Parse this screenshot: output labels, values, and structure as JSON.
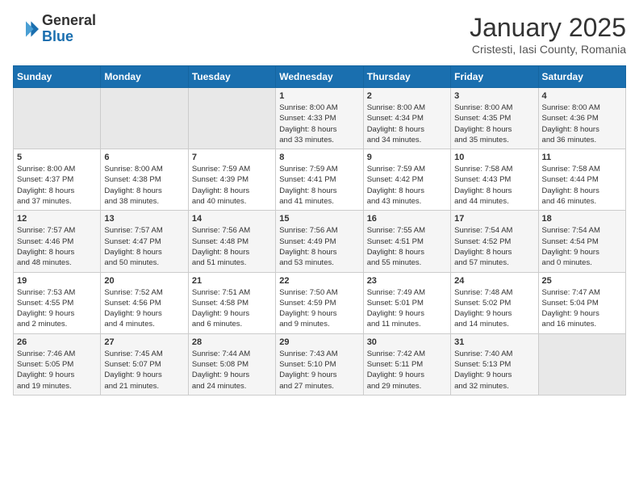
{
  "logo": {
    "general": "General",
    "blue": "Blue"
  },
  "title": "January 2025",
  "location": "Cristesti, Iasi County, Romania",
  "days_of_week": [
    "Sunday",
    "Monday",
    "Tuesday",
    "Wednesday",
    "Thursday",
    "Friday",
    "Saturday"
  ],
  "weeks": [
    [
      {
        "num": "",
        "info": ""
      },
      {
        "num": "",
        "info": ""
      },
      {
        "num": "",
        "info": ""
      },
      {
        "num": "1",
        "info": "Sunrise: 8:00 AM\nSunset: 4:33 PM\nDaylight: 8 hours\nand 33 minutes."
      },
      {
        "num": "2",
        "info": "Sunrise: 8:00 AM\nSunset: 4:34 PM\nDaylight: 8 hours\nand 34 minutes."
      },
      {
        "num": "3",
        "info": "Sunrise: 8:00 AM\nSunset: 4:35 PM\nDaylight: 8 hours\nand 35 minutes."
      },
      {
        "num": "4",
        "info": "Sunrise: 8:00 AM\nSunset: 4:36 PM\nDaylight: 8 hours\nand 36 minutes."
      }
    ],
    [
      {
        "num": "5",
        "info": "Sunrise: 8:00 AM\nSunset: 4:37 PM\nDaylight: 8 hours\nand 37 minutes."
      },
      {
        "num": "6",
        "info": "Sunrise: 8:00 AM\nSunset: 4:38 PM\nDaylight: 8 hours\nand 38 minutes."
      },
      {
        "num": "7",
        "info": "Sunrise: 7:59 AM\nSunset: 4:39 PM\nDaylight: 8 hours\nand 40 minutes."
      },
      {
        "num": "8",
        "info": "Sunrise: 7:59 AM\nSunset: 4:41 PM\nDaylight: 8 hours\nand 41 minutes."
      },
      {
        "num": "9",
        "info": "Sunrise: 7:59 AM\nSunset: 4:42 PM\nDaylight: 8 hours\nand 43 minutes."
      },
      {
        "num": "10",
        "info": "Sunrise: 7:58 AM\nSunset: 4:43 PM\nDaylight: 8 hours\nand 44 minutes."
      },
      {
        "num": "11",
        "info": "Sunrise: 7:58 AM\nSunset: 4:44 PM\nDaylight: 8 hours\nand 46 minutes."
      }
    ],
    [
      {
        "num": "12",
        "info": "Sunrise: 7:57 AM\nSunset: 4:46 PM\nDaylight: 8 hours\nand 48 minutes."
      },
      {
        "num": "13",
        "info": "Sunrise: 7:57 AM\nSunset: 4:47 PM\nDaylight: 8 hours\nand 50 minutes."
      },
      {
        "num": "14",
        "info": "Sunrise: 7:56 AM\nSunset: 4:48 PM\nDaylight: 8 hours\nand 51 minutes."
      },
      {
        "num": "15",
        "info": "Sunrise: 7:56 AM\nSunset: 4:49 PM\nDaylight: 8 hours\nand 53 minutes."
      },
      {
        "num": "16",
        "info": "Sunrise: 7:55 AM\nSunset: 4:51 PM\nDaylight: 8 hours\nand 55 minutes."
      },
      {
        "num": "17",
        "info": "Sunrise: 7:54 AM\nSunset: 4:52 PM\nDaylight: 8 hours\nand 57 minutes."
      },
      {
        "num": "18",
        "info": "Sunrise: 7:54 AM\nSunset: 4:54 PM\nDaylight: 9 hours\nand 0 minutes."
      }
    ],
    [
      {
        "num": "19",
        "info": "Sunrise: 7:53 AM\nSunset: 4:55 PM\nDaylight: 9 hours\nand 2 minutes."
      },
      {
        "num": "20",
        "info": "Sunrise: 7:52 AM\nSunset: 4:56 PM\nDaylight: 9 hours\nand 4 minutes."
      },
      {
        "num": "21",
        "info": "Sunrise: 7:51 AM\nSunset: 4:58 PM\nDaylight: 9 hours\nand 6 minutes."
      },
      {
        "num": "22",
        "info": "Sunrise: 7:50 AM\nSunset: 4:59 PM\nDaylight: 9 hours\nand 9 minutes."
      },
      {
        "num": "23",
        "info": "Sunrise: 7:49 AM\nSunset: 5:01 PM\nDaylight: 9 hours\nand 11 minutes."
      },
      {
        "num": "24",
        "info": "Sunrise: 7:48 AM\nSunset: 5:02 PM\nDaylight: 9 hours\nand 14 minutes."
      },
      {
        "num": "25",
        "info": "Sunrise: 7:47 AM\nSunset: 5:04 PM\nDaylight: 9 hours\nand 16 minutes."
      }
    ],
    [
      {
        "num": "26",
        "info": "Sunrise: 7:46 AM\nSunset: 5:05 PM\nDaylight: 9 hours\nand 19 minutes."
      },
      {
        "num": "27",
        "info": "Sunrise: 7:45 AM\nSunset: 5:07 PM\nDaylight: 9 hours\nand 21 minutes."
      },
      {
        "num": "28",
        "info": "Sunrise: 7:44 AM\nSunset: 5:08 PM\nDaylight: 9 hours\nand 24 minutes."
      },
      {
        "num": "29",
        "info": "Sunrise: 7:43 AM\nSunset: 5:10 PM\nDaylight: 9 hours\nand 27 minutes."
      },
      {
        "num": "30",
        "info": "Sunrise: 7:42 AM\nSunset: 5:11 PM\nDaylight: 9 hours\nand 29 minutes."
      },
      {
        "num": "31",
        "info": "Sunrise: 7:40 AM\nSunset: 5:13 PM\nDaylight: 9 hours\nand 32 minutes."
      },
      {
        "num": "",
        "info": ""
      }
    ]
  ]
}
